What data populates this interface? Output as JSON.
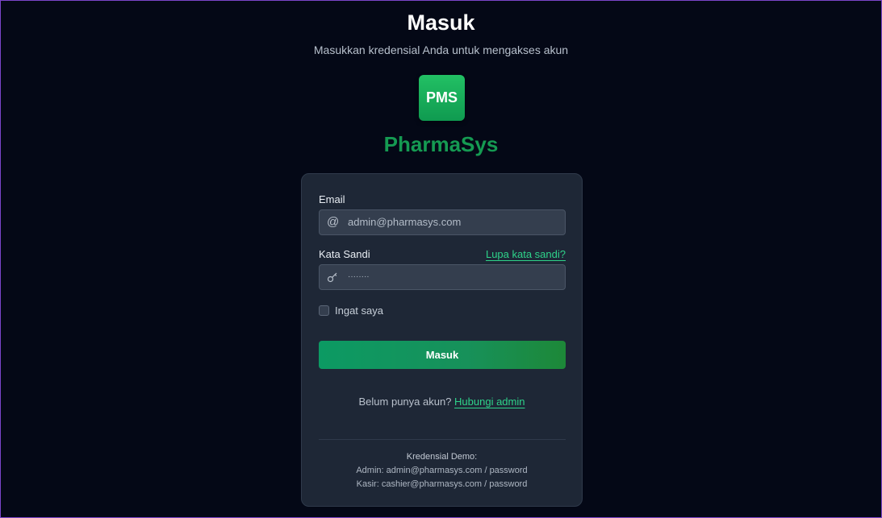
{
  "header": {
    "title": "Masuk",
    "subtitle": "Masukkan kredensial Anda untuk mengakses akun"
  },
  "brand": {
    "logo_text": "PMS",
    "name": "PharmaSys",
    "logo_color": "#16a85a",
    "name_color": "#159a52"
  },
  "form": {
    "email_label": "Email",
    "email_icon": "at-icon",
    "email_placeholder": "admin@pharmasys.com",
    "password_label": "Kata Sandi",
    "password_icon": "key-icon",
    "password_placeholder": "········",
    "forgot_link": "Lupa kata sandi?",
    "remember_label": "Ingat saya",
    "remember_checked": false,
    "submit_label": "Masuk",
    "signup_prompt": "Belum punya akun?",
    "signup_link": "Hubungi admin"
  },
  "demo": {
    "title": "Kredensial Demo:",
    "admin_line": "Admin: admin@pharmasys.com / password",
    "cashier_line": "Kasir: cashier@pharmasys.com / password"
  },
  "colors": {
    "background": "#040816",
    "card": "#1e2736",
    "accent": "#2ed38a",
    "button": "#12955c"
  }
}
